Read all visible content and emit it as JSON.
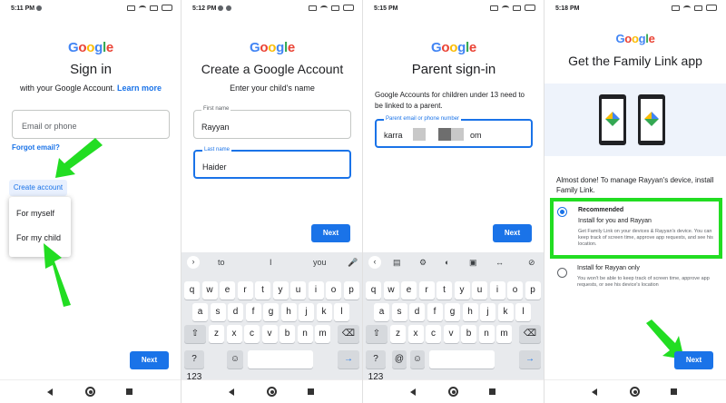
{
  "screens": [
    {
      "status_time": "5:11 PM",
      "logo": [
        "G",
        "o",
        "o",
        "g",
        "l",
        "e"
      ],
      "title": "Sign in",
      "subtitle": "with your Google Account.",
      "learn_more": "Learn more",
      "email_placeholder": "Email or phone",
      "forgot_email": "Forgot email?",
      "create_account": "Create account",
      "menu": {
        "for_myself": "For myself",
        "for_my_child": "For my child"
      },
      "next": "Next"
    },
    {
      "status_time": "5:12 PM",
      "logo": [
        "G",
        "o",
        "o",
        "g",
        "l",
        "e"
      ],
      "title": "Create a Google Account",
      "subtitle": "Enter your child's name",
      "first_name_label": "First name",
      "first_name_value": "Rayyan",
      "last_name_label": "Last name",
      "last_name_value": "Haider",
      "next": "Next",
      "suggestions": [
        "to",
        "I",
        "you"
      ],
      "keyboard_rows": [
        [
          "q",
          "w",
          "e",
          "r",
          "t",
          "y",
          "u",
          "i",
          "o",
          "p"
        ],
        [
          "a",
          "s",
          "d",
          "f",
          "g",
          "h",
          "j",
          "k",
          "l"
        ],
        [
          "z",
          "x",
          "c",
          "v",
          "b",
          "n",
          "m"
        ]
      ],
      "sym_key": "?123"
    },
    {
      "status_time": "5:15 PM",
      "logo": [
        "G",
        "o",
        "o",
        "g",
        "l",
        "e"
      ],
      "title": "Parent sign-in",
      "description": "Google Accounts for children under 13 need to be linked to a parent.",
      "email_label": "Parent email or phone number",
      "email_value_start": "karra",
      "email_value_end": "om",
      "next": "Next",
      "keyboard_rows": [
        [
          "q",
          "w",
          "e",
          "r",
          "t",
          "y",
          "u",
          "i",
          "o",
          "p"
        ],
        [
          "a",
          "s",
          "d",
          "f",
          "g",
          "h",
          "j",
          "k",
          "l"
        ],
        [
          "z",
          "x",
          "c",
          "v",
          "b",
          "n",
          "m"
        ]
      ],
      "sym_key": "?123",
      "at_key": "@"
    },
    {
      "status_time": "5:18 PM",
      "logo": [
        "G",
        "o",
        "o",
        "g",
        "l",
        "e"
      ],
      "title": "Get the Family Link app",
      "description": "Almost done! To manage Rayyan's device, install Family Link.",
      "option1": {
        "title": "Recommended",
        "subtitle": "Install for you and Rayyan",
        "detail": "Get Family Link on your devices & Rayyan's device. You can keep track of screen time, approve app requests, and see his location."
      },
      "option2": {
        "title": "Install for Rayyan only",
        "detail": "You won't be able to keep track of screen time, approve app requests, or see his device's location"
      },
      "next": "Next"
    }
  ],
  "colors": {
    "accent": "#1a73e8",
    "highlight_green": "#22dd22"
  }
}
